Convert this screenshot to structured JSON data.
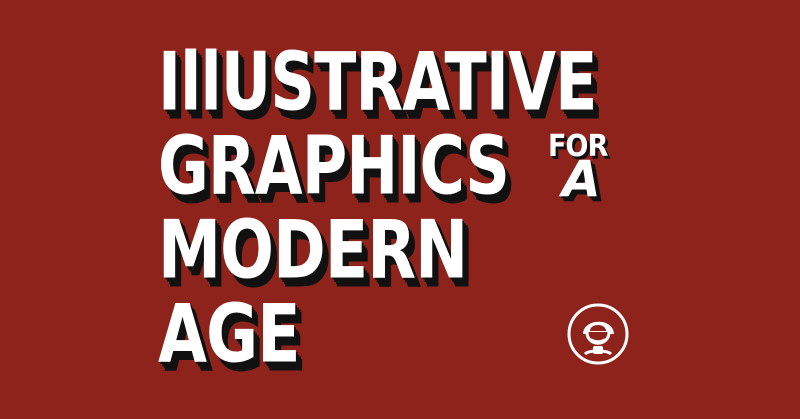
{
  "colors": {
    "background": "#8e231c",
    "text": "#ffffff",
    "shadow": "#111111"
  },
  "title": {
    "line1": "IllUSTRATIVE",
    "line2": "GRAPHICS",
    "line3": "MODERN",
    "line4": "AGE"
  },
  "for_a": {
    "for": "FOR",
    "a": "A"
  },
  "badge": {
    "icon": "girl-face-icon"
  }
}
